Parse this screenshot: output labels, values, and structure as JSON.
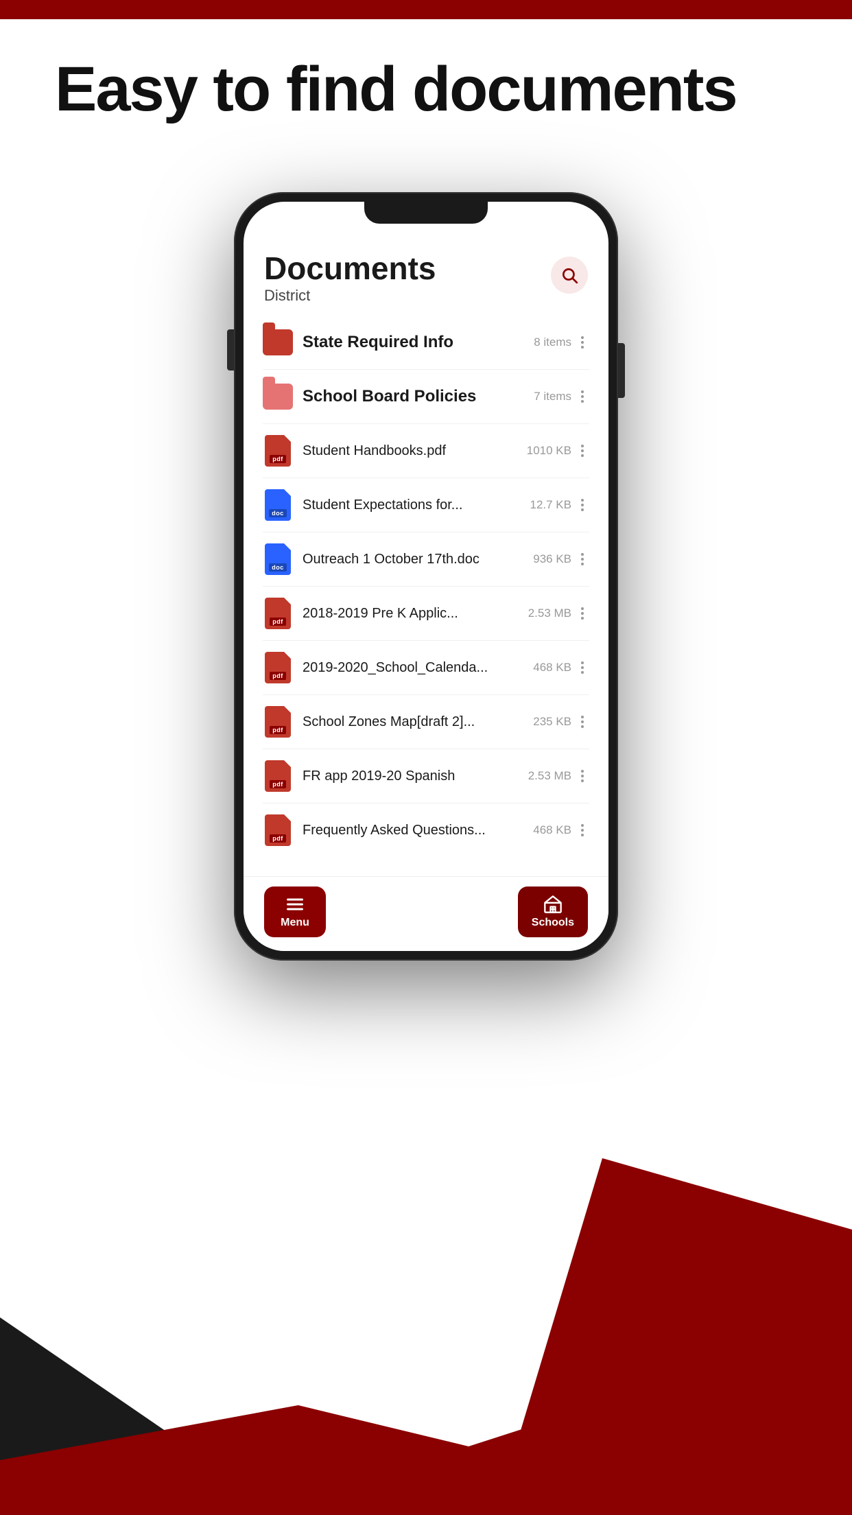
{
  "page": {
    "headline": "Easy to find documents",
    "top_bar_color": "#8b0000"
  },
  "screen": {
    "title": "Documents",
    "subtitle": "District",
    "search_aria": "Search"
  },
  "documents": [
    {
      "id": 1,
      "name": "State Required Info",
      "type": "folder",
      "variant": "red",
      "meta": "8 items",
      "bold": true
    },
    {
      "id": 2,
      "name": "School Board Policies",
      "type": "folder",
      "variant": "light-red",
      "meta": "7 items",
      "bold": true
    },
    {
      "id": 3,
      "name": "Student Handbooks.pdf",
      "type": "pdf",
      "meta": "1010 KB",
      "bold": false
    },
    {
      "id": 4,
      "name": "Student Expectations for...",
      "type": "doc",
      "meta": "12.7 KB",
      "bold": false
    },
    {
      "id": 5,
      "name": "Outreach 1 October 17th.doc",
      "type": "doc",
      "meta": "936 KB",
      "bold": false
    },
    {
      "id": 6,
      "name": "2018-2019 Pre K Applic...",
      "type": "pdf",
      "meta": "2.53 MB",
      "bold": false
    },
    {
      "id": 7,
      "name": "2019-2020_School_Calenda...",
      "type": "pdf",
      "meta": "468 KB",
      "bold": false
    },
    {
      "id": 8,
      "name": "School Zones Map[draft 2]...",
      "type": "pdf",
      "meta": "235 KB",
      "bold": false
    },
    {
      "id": 9,
      "name": "FR app 2019-20 Spanish",
      "type": "pdf",
      "meta": "2.53 MB",
      "bold": false
    },
    {
      "id": 10,
      "name": "Frequently Asked Questions...",
      "type": "pdf",
      "meta": "468 KB",
      "bold": false
    }
  ],
  "bottom_nav": {
    "menu_label": "Menu",
    "schools_label": "Schools"
  }
}
